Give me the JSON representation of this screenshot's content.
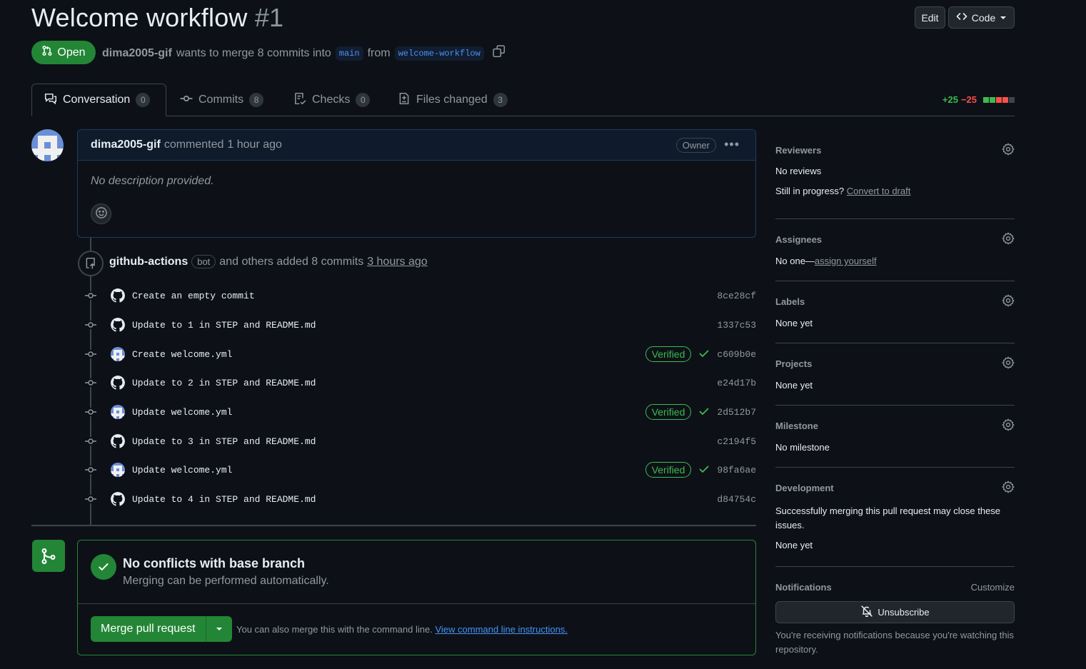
{
  "header": {
    "title": "Welcome workflow",
    "number": "#1",
    "edit_label": "Edit",
    "code_label": "Code"
  },
  "pr": {
    "state": "Open",
    "author": "dima2005-gif",
    "wants_text": "wants to merge 8 commits into",
    "base_branch": "main",
    "from_text": "from",
    "head_branch": "welcome-workflow"
  },
  "tabs": [
    {
      "label": "Conversation",
      "count": "0"
    },
    {
      "label": "Commits",
      "count": "8"
    },
    {
      "label": "Checks",
      "count": "0"
    },
    {
      "label": "Files changed",
      "count": "3"
    }
  ],
  "diffstat": {
    "additions": "+25",
    "deletions": "−25"
  },
  "comment": {
    "author": "dima2005-gif",
    "action": "commented",
    "time": "1 hour ago",
    "role": "Owner",
    "body": "No description provided."
  },
  "push_event": {
    "actor": "github-actions",
    "badge": "bot",
    "text": "and others added 8 commits",
    "time": "3 hours ago"
  },
  "commits": [
    {
      "message": "Create an empty commit",
      "sha": "8ce28cf",
      "verified": false,
      "avatar": "github"
    },
    {
      "message": "Update to 1 in STEP and README.md",
      "sha": "1337c53",
      "verified": false,
      "avatar": "github"
    },
    {
      "message": "Create welcome.yml",
      "sha": "c609b0e",
      "verified": true,
      "avatar": "user"
    },
    {
      "message": "Update to 2 in STEP and README.md",
      "sha": "e24d17b",
      "verified": false,
      "avatar": "github"
    },
    {
      "message": "Update welcome.yml",
      "sha": "2d512b7",
      "verified": true,
      "avatar": "user"
    },
    {
      "message": "Update to 3 in STEP and README.md",
      "sha": "c2194f5",
      "verified": false,
      "avatar": "github"
    },
    {
      "message": "Update welcome.yml",
      "sha": "98fa6ae",
      "verified": true,
      "avatar": "user"
    },
    {
      "message": "Update to 4 in STEP and README.md",
      "sha": "d84754c",
      "verified": false,
      "avatar": "github"
    }
  ],
  "verified_label": "Verified",
  "merge": {
    "title": "No conflicts with base branch",
    "subtitle": "Merging can be performed automatically.",
    "button": "Merge pull request",
    "hint": "You can also merge this with the command line.",
    "hint_link": "View command line instructions."
  },
  "sidebar": {
    "reviewers": {
      "title": "Reviewers",
      "value": "No reviews",
      "progress_text": "Still in progress?",
      "progress_link": "Convert to draft"
    },
    "assignees": {
      "title": "Assignees",
      "value": "No one—",
      "link": "assign yourself"
    },
    "labels": {
      "title": "Labels",
      "value": "None yet"
    },
    "projects": {
      "title": "Projects",
      "value": "None yet"
    },
    "milestone": {
      "title": "Milestone",
      "value": "No milestone"
    },
    "development": {
      "title": "Development",
      "description": "Successfully merging this pull request may close these issues.",
      "value": "None yet"
    },
    "notifications": {
      "title": "Notifications",
      "customize": "Customize",
      "button": "Unsubscribe",
      "reason": "You're receiving notifications because you're watching this repository."
    }
  },
  "colors": {
    "accent": "#4493f8",
    "success": "#238636",
    "danger": "#f85149",
    "bg": "#0d1117"
  }
}
